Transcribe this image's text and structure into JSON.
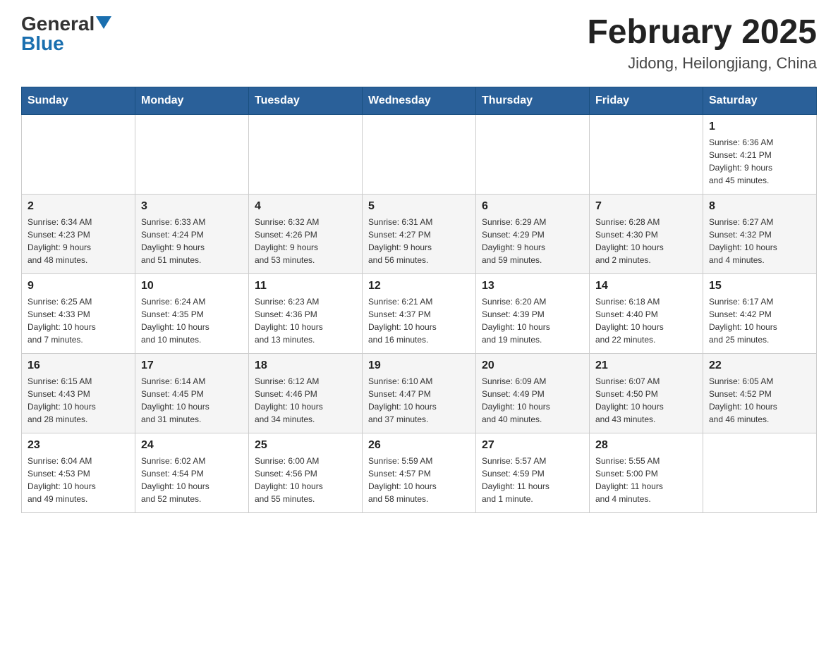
{
  "header": {
    "logo_general": "General",
    "logo_blue": "Blue",
    "month_year": "February 2025",
    "location": "Jidong, Heilongjiang, China"
  },
  "weekdays": [
    "Sunday",
    "Monday",
    "Tuesday",
    "Wednesday",
    "Thursday",
    "Friday",
    "Saturday"
  ],
  "weeks": [
    {
      "days": [
        {
          "number": "",
          "info": ""
        },
        {
          "number": "",
          "info": ""
        },
        {
          "number": "",
          "info": ""
        },
        {
          "number": "",
          "info": ""
        },
        {
          "number": "",
          "info": ""
        },
        {
          "number": "",
          "info": ""
        },
        {
          "number": "1",
          "info": "Sunrise: 6:36 AM\nSunset: 4:21 PM\nDaylight: 9 hours\nand 45 minutes."
        }
      ]
    },
    {
      "days": [
        {
          "number": "2",
          "info": "Sunrise: 6:34 AM\nSunset: 4:23 PM\nDaylight: 9 hours\nand 48 minutes."
        },
        {
          "number": "3",
          "info": "Sunrise: 6:33 AM\nSunset: 4:24 PM\nDaylight: 9 hours\nand 51 minutes."
        },
        {
          "number": "4",
          "info": "Sunrise: 6:32 AM\nSunset: 4:26 PM\nDaylight: 9 hours\nand 53 minutes."
        },
        {
          "number": "5",
          "info": "Sunrise: 6:31 AM\nSunset: 4:27 PM\nDaylight: 9 hours\nand 56 minutes."
        },
        {
          "number": "6",
          "info": "Sunrise: 6:29 AM\nSunset: 4:29 PM\nDaylight: 9 hours\nand 59 minutes."
        },
        {
          "number": "7",
          "info": "Sunrise: 6:28 AM\nSunset: 4:30 PM\nDaylight: 10 hours\nand 2 minutes."
        },
        {
          "number": "8",
          "info": "Sunrise: 6:27 AM\nSunset: 4:32 PM\nDaylight: 10 hours\nand 4 minutes."
        }
      ]
    },
    {
      "days": [
        {
          "number": "9",
          "info": "Sunrise: 6:25 AM\nSunset: 4:33 PM\nDaylight: 10 hours\nand 7 minutes."
        },
        {
          "number": "10",
          "info": "Sunrise: 6:24 AM\nSunset: 4:35 PM\nDaylight: 10 hours\nand 10 minutes."
        },
        {
          "number": "11",
          "info": "Sunrise: 6:23 AM\nSunset: 4:36 PM\nDaylight: 10 hours\nand 13 minutes."
        },
        {
          "number": "12",
          "info": "Sunrise: 6:21 AM\nSunset: 4:37 PM\nDaylight: 10 hours\nand 16 minutes."
        },
        {
          "number": "13",
          "info": "Sunrise: 6:20 AM\nSunset: 4:39 PM\nDaylight: 10 hours\nand 19 minutes."
        },
        {
          "number": "14",
          "info": "Sunrise: 6:18 AM\nSunset: 4:40 PM\nDaylight: 10 hours\nand 22 minutes."
        },
        {
          "number": "15",
          "info": "Sunrise: 6:17 AM\nSunset: 4:42 PM\nDaylight: 10 hours\nand 25 minutes."
        }
      ]
    },
    {
      "days": [
        {
          "number": "16",
          "info": "Sunrise: 6:15 AM\nSunset: 4:43 PM\nDaylight: 10 hours\nand 28 minutes."
        },
        {
          "number": "17",
          "info": "Sunrise: 6:14 AM\nSunset: 4:45 PM\nDaylight: 10 hours\nand 31 minutes."
        },
        {
          "number": "18",
          "info": "Sunrise: 6:12 AM\nSunset: 4:46 PM\nDaylight: 10 hours\nand 34 minutes."
        },
        {
          "number": "19",
          "info": "Sunrise: 6:10 AM\nSunset: 4:47 PM\nDaylight: 10 hours\nand 37 minutes."
        },
        {
          "number": "20",
          "info": "Sunrise: 6:09 AM\nSunset: 4:49 PM\nDaylight: 10 hours\nand 40 minutes."
        },
        {
          "number": "21",
          "info": "Sunrise: 6:07 AM\nSunset: 4:50 PM\nDaylight: 10 hours\nand 43 minutes."
        },
        {
          "number": "22",
          "info": "Sunrise: 6:05 AM\nSunset: 4:52 PM\nDaylight: 10 hours\nand 46 minutes."
        }
      ]
    },
    {
      "days": [
        {
          "number": "23",
          "info": "Sunrise: 6:04 AM\nSunset: 4:53 PM\nDaylight: 10 hours\nand 49 minutes."
        },
        {
          "number": "24",
          "info": "Sunrise: 6:02 AM\nSunset: 4:54 PM\nDaylight: 10 hours\nand 52 minutes."
        },
        {
          "number": "25",
          "info": "Sunrise: 6:00 AM\nSunset: 4:56 PM\nDaylight: 10 hours\nand 55 minutes."
        },
        {
          "number": "26",
          "info": "Sunrise: 5:59 AM\nSunset: 4:57 PM\nDaylight: 10 hours\nand 58 minutes."
        },
        {
          "number": "27",
          "info": "Sunrise: 5:57 AM\nSunset: 4:59 PM\nDaylight: 11 hours\nand 1 minute."
        },
        {
          "number": "28",
          "info": "Sunrise: 5:55 AM\nSunset: 5:00 PM\nDaylight: 11 hours\nand 4 minutes."
        },
        {
          "number": "",
          "info": ""
        }
      ]
    }
  ]
}
